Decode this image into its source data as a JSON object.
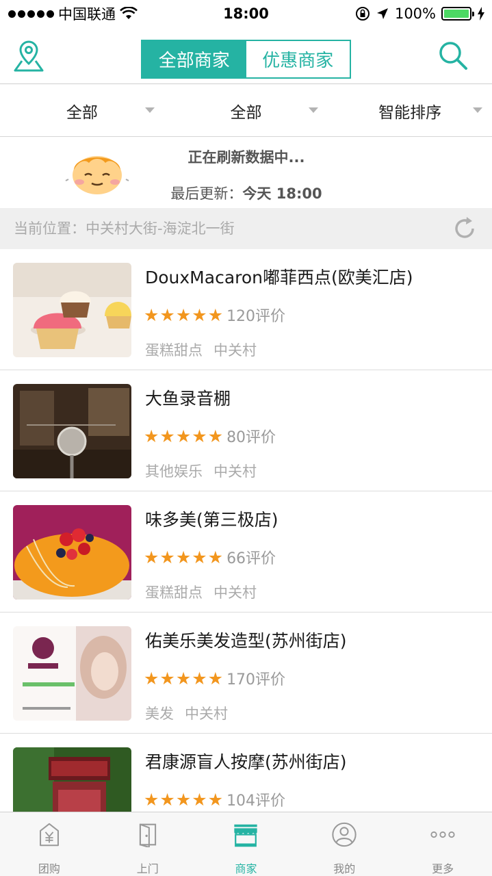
{
  "status_bar": {
    "carrier": "中国联通",
    "time": "18:00",
    "battery_percent": "100%",
    "battery_level": 1.0
  },
  "nav": {
    "tabs": [
      "全部商家",
      "优惠商家"
    ],
    "active_tab": 0,
    "accent": "#25b3a3"
  },
  "filters": [
    "全部",
    "全部",
    "智能排序"
  ],
  "refresh": {
    "title": "正在刷新数据中...",
    "last_update_label": "最后更新：",
    "last_update_value": "今天 18:00"
  },
  "location": {
    "label": "当前位置：",
    "value": "中关村大街-海淀北一街"
  },
  "shops": [
    {
      "name": "DouxMacaron嘟菲西点(欧美汇店)",
      "stars": "★★★★★",
      "reviews": "120评价",
      "category": "蛋糕甜点",
      "area": "中关村"
    },
    {
      "name": "大鱼录音棚",
      "stars": "★★★★★",
      "reviews": "80评价",
      "category": "其他娱乐",
      "area": "中关村"
    },
    {
      "name": "味多美(第三极店)",
      "stars": "★★★★★",
      "reviews": "66评价",
      "category": "蛋糕甜点",
      "area": "中关村"
    },
    {
      "name": "佑美乐美发造型(苏州街店)",
      "stars": "★★★★★",
      "reviews": "170评价",
      "category": "美发",
      "area": "中关村"
    },
    {
      "name": "君康源盲人按摩(苏州街店)",
      "stars": "★★★★★",
      "reviews": "104评价",
      "category": "",
      "area": ""
    }
  ],
  "tabbar": {
    "items": [
      {
        "label": "团购",
        "icon": "yuan-bag-icon"
      },
      {
        "label": "上门",
        "icon": "door-icon"
      },
      {
        "label": "商家",
        "icon": "storefront-icon"
      },
      {
        "label": "我的",
        "icon": "user-icon"
      },
      {
        "label": "更多",
        "icon": "more-dots-icon"
      }
    ],
    "active_index": 2
  }
}
